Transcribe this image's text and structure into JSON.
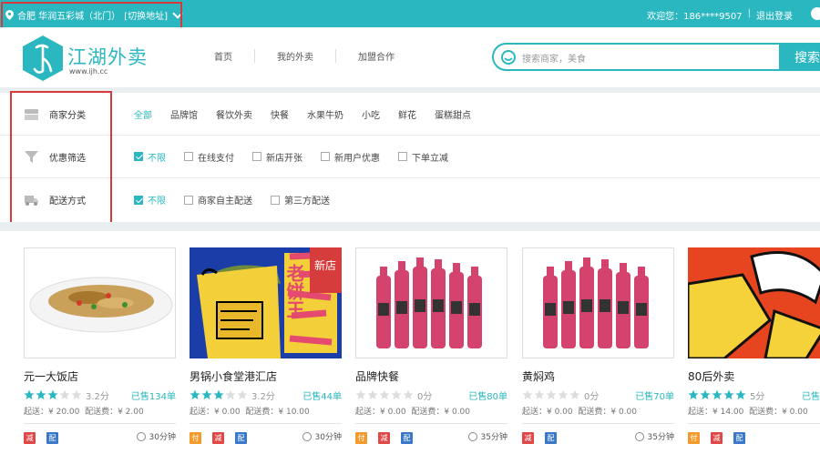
{
  "topbar": {
    "location": "合肥  华润五彩城（北门）",
    "switch_label": "[切换地址]",
    "welcome": "欢迎您：",
    "phone": "186****9507",
    "separator": "|",
    "logout": "退出登录"
  },
  "header": {
    "logo_text": "江湖外卖",
    "logo_url": "www.ijh.cc",
    "nav": [
      "首页",
      "我的外卖",
      "加盟合作"
    ],
    "search_placeholder": "搜索商家，美食",
    "search_button": "搜索"
  },
  "filters": {
    "category": {
      "label": "商家分类",
      "options": [
        "全部",
        "品牌馆",
        "餐饮外卖",
        "快餐",
        "水果牛奶",
        "小吃",
        "鲜花",
        "蛋糕甜点"
      ]
    },
    "discount": {
      "label": "优惠筛选",
      "options": [
        "不限",
        "在线支付",
        "新店开张",
        "新用户优惠",
        "下单立减"
      ]
    },
    "delivery": {
      "label": "配送方式",
      "options": [
        "不限",
        "商家自主配送",
        "第三方配送"
      ]
    }
  },
  "shops": [
    {
      "name": "元一大饭店",
      "rating": 3,
      "score": "3.2分",
      "sold": "已售134单",
      "min": "起送：¥ 20.00",
      "fee": "配送费：¥ 2.00",
      "time": "30分钟",
      "tags": [
        "减",
        "配"
      ]
    },
    {
      "name": "男锅小食堂港汇店",
      "rating": 3,
      "score": "3.2分",
      "sold": "已售44单",
      "min": "起送：¥ 0.00",
      "fee": "配送费：¥ 10.00",
      "time": "30分钟",
      "tags": [
        "付",
        "减",
        "配"
      ]
    },
    {
      "name": "品牌快餐",
      "rating": 0,
      "score": "0分",
      "sold": "已售80单",
      "min": "起送：¥ 0.00",
      "fee": "配送费：¥ 0.00",
      "time": "35分钟",
      "tags": [
        "付",
        "减",
        "配"
      ]
    },
    {
      "name": "黄焖鸡",
      "rating": 0,
      "score": "0分",
      "sold": "已售70单",
      "min": "起送：¥ 0.00",
      "fee": "配送费：¥ 0.00",
      "time": "35分钟",
      "tags": [
        "减",
        "配"
      ]
    },
    {
      "name": "80后外卖",
      "rating": 5,
      "score": "5分",
      "sold": "已售",
      "min": "起送：¥ 14.00",
      "fee": "配送费：¥ 0.00",
      "time": "",
      "tags": [
        "付",
        "减",
        "配"
      ]
    }
  ],
  "card2_badge": "新店",
  "card2_sign": "老饼王",
  "colors": {
    "accent": "#2ab7bf",
    "highlight_box": "#d63a3a",
    "star": "#2ab7bf"
  }
}
